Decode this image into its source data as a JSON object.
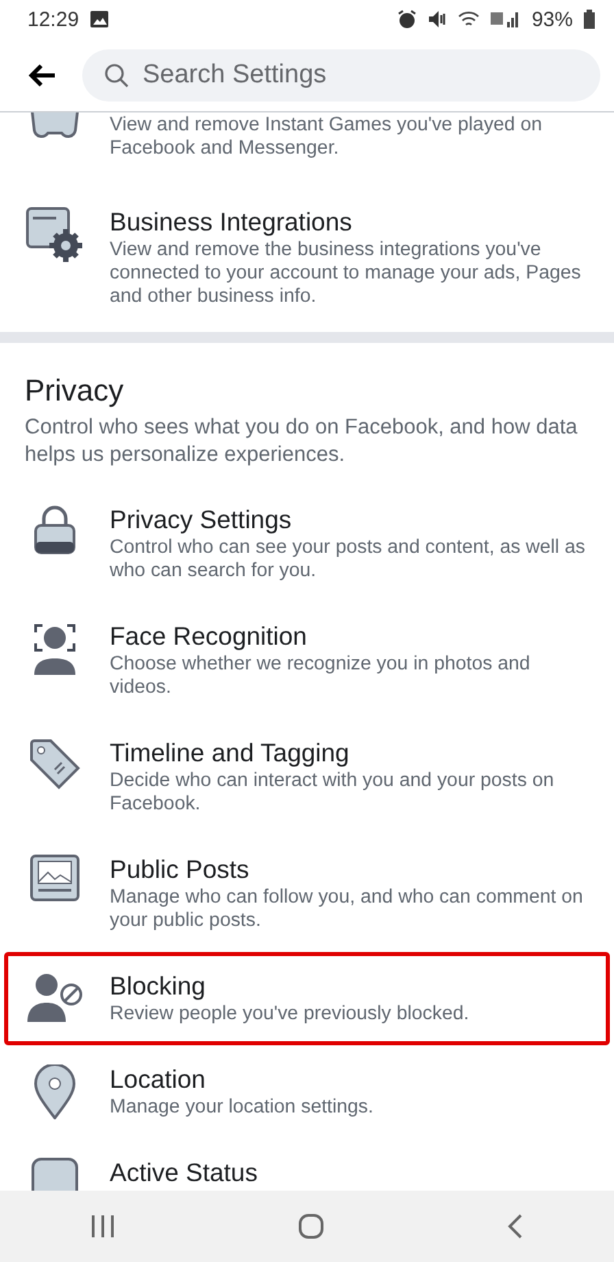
{
  "status_bar": {
    "time": "12:29",
    "battery": "93%"
  },
  "search": {
    "placeholder": "Search Settings"
  },
  "top_items": [
    {
      "description": "View and remove Instant Games you've played on Facebook and Messenger."
    },
    {
      "title": "Business Integrations",
      "description": "View and remove the business integrations you've connected to your account to manage your ads, Pages and other business info."
    }
  ],
  "privacy": {
    "heading": "Privacy",
    "description": "Control who sees what you do on Facebook, and how data helps us personalize experiences.",
    "items": [
      {
        "title": "Privacy Settings",
        "description": "Control who can see your posts and content, as well as who can search for you.",
        "highlighted": false
      },
      {
        "title": "Face Recognition",
        "description": "Choose whether we recognize you in photos and videos.",
        "highlighted": false
      },
      {
        "title": "Timeline and Tagging",
        "description": "Decide who can interact with you and your posts on Facebook.",
        "highlighted": false
      },
      {
        "title": "Public Posts",
        "description": "Manage who can follow you, and who can comment on your public posts.",
        "highlighted": false
      },
      {
        "title": "Blocking",
        "description": "Review people you've previously blocked.",
        "highlighted": true
      },
      {
        "title": "Location",
        "description": "Manage your location settings.",
        "highlighted": false
      },
      {
        "title": "Active Status",
        "highlighted": false
      }
    ]
  }
}
